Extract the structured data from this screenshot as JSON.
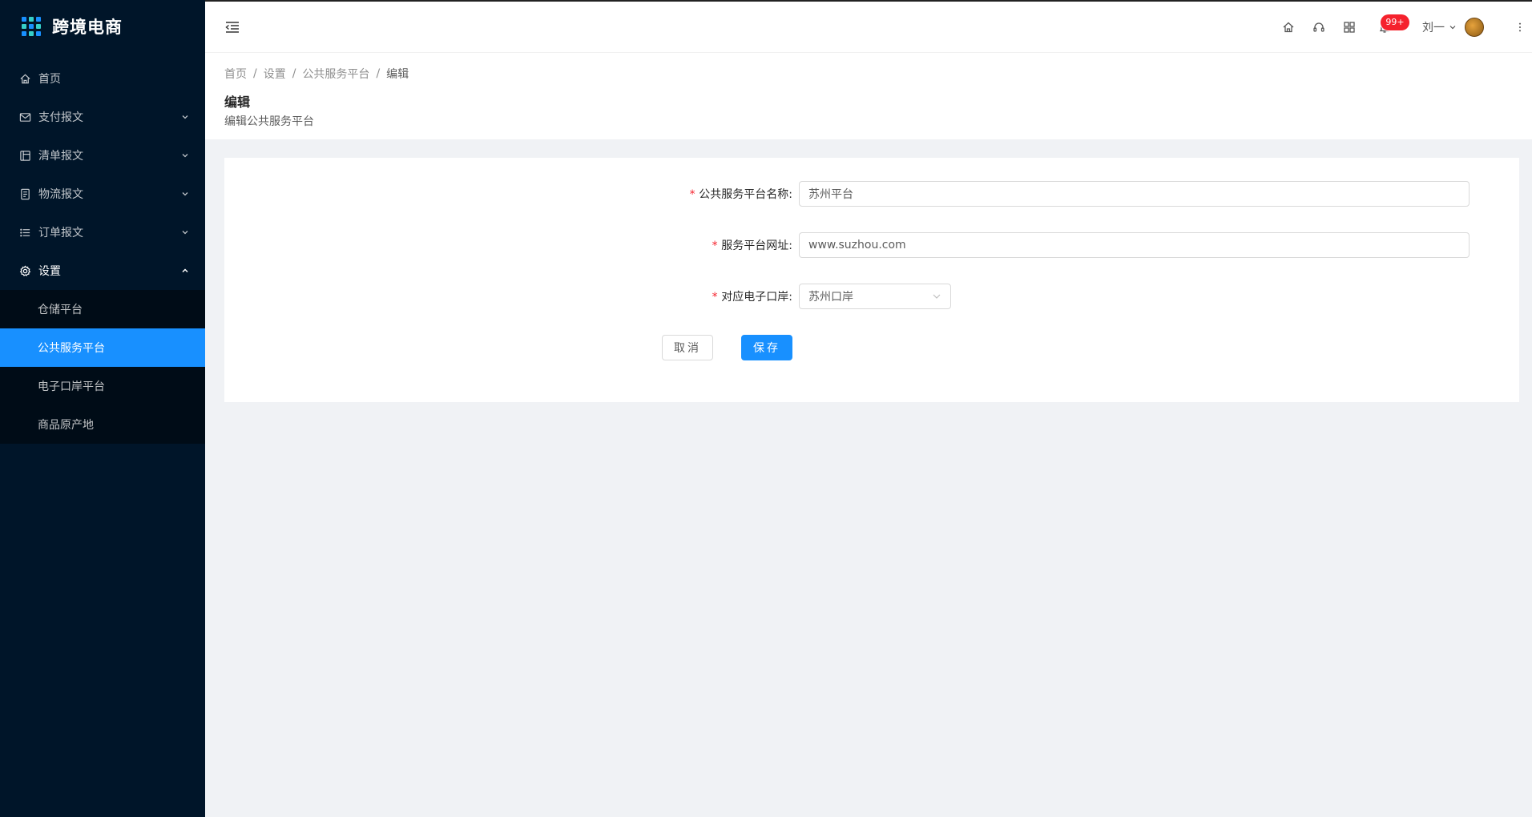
{
  "app": {
    "title": "跨境电商"
  },
  "sidebar": {
    "items": [
      {
        "label": "首页"
      },
      {
        "label": "支付报文"
      },
      {
        "label": "清单报文"
      },
      {
        "label": "物流报文"
      },
      {
        "label": "订单报文"
      },
      {
        "label": "设置"
      }
    ],
    "settings_children": [
      {
        "label": "仓储平台"
      },
      {
        "label": "公共服务平台"
      },
      {
        "label": "电子口岸平台"
      },
      {
        "label": "商品原产地"
      }
    ]
  },
  "header": {
    "notification_count": "99+",
    "username": "刘一"
  },
  "breadcrumb": [
    "首页",
    "设置",
    "公共服务平台",
    "编辑"
  ],
  "page": {
    "title": "编辑",
    "description": "编辑公共服务平台"
  },
  "form": {
    "name_label": "公共服务平台名称:",
    "name_value": "苏州平台",
    "url_label": "服务平台网址:",
    "url_value": "www.suzhou.com",
    "port_label": "对应电子口岸:",
    "port_value": "苏州口岸",
    "required_mark": "*",
    "cancel_label": "取消",
    "save_label": "保存"
  },
  "colors": {
    "sidebar_bg": "#001529",
    "submenu_bg": "#000c17",
    "primary": "#1890ff",
    "danger": "#f5222d"
  }
}
